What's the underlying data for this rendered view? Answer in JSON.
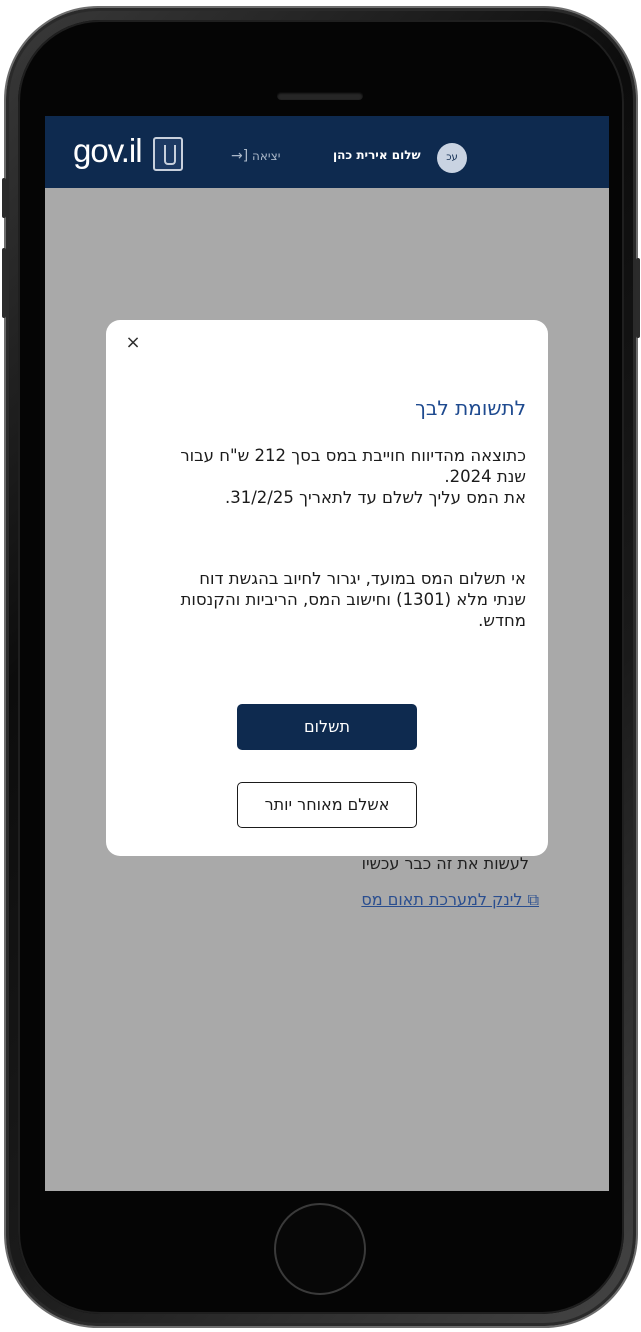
{
  "header": {
    "logo_text": "gov.il",
    "user_initials": "עכ",
    "user_greeting": "שלום אירית כהן",
    "logout_label": "יציאה"
  },
  "background": {
    "text": "לעשות את זה כבר עכשיו",
    "link_text": "לינק למערכת תאום מס"
  },
  "modal": {
    "title": "לתשומת לבך",
    "paragraph1_lines": [
      "כתוצאה מהדיווח חוייבת במס בסך 212 ש\"ח עבור",
      "שנת 2024.",
      "את המס עליך לשלם עד לתאריך 31/2/25."
    ],
    "paragraph2_lines": [
      "אי תשלום המס במועד, יגרור לחיוב בהגשת דוח",
      "שנתי מלא (1301) וחישוב המס, הריביות והקנסות",
      "מחדש."
    ],
    "pay_button_label": "תשלום",
    "later_button_label": "אשלם מאוחר יותר",
    "close_symbol": "×"
  },
  "colors": {
    "header_bg": "#0e2a4f",
    "primary_button": "#0e2a4f",
    "title_color": "#1e4a8f",
    "overlay": "#a9a9a9"
  }
}
